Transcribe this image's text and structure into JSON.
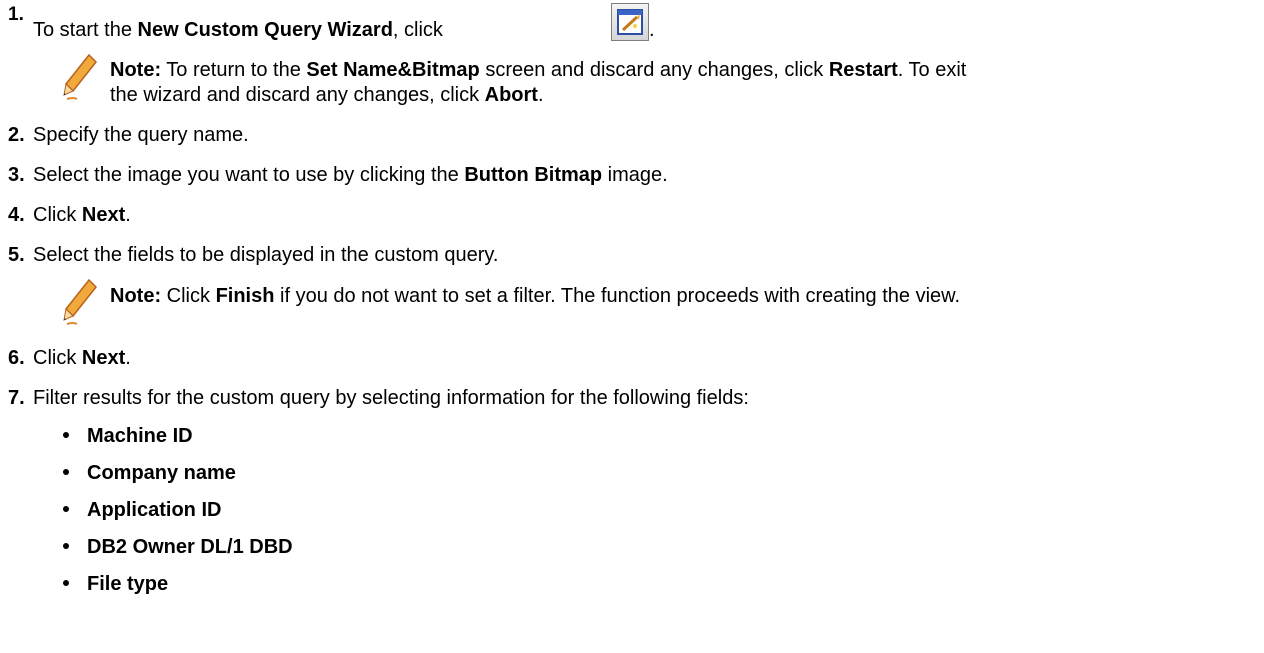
{
  "step1": {
    "number": "1.",
    "text_before": "To start the ",
    "wizard_name": "New Custom Query Wizard",
    "text_after": ", click ",
    "icon": "custom-query-wizard-icon",
    "trailing": "."
  },
  "note1": {
    "icon": "pencil-icon",
    "label": "Note:",
    "line1_a": " To return to the ",
    "line1_b": "Set Name&Bitmap",
    "line1_c": " screen and discard any changes, click ",
    "line1_d": "Restart",
    "line1_e": ". To exit",
    "line2_a": "the wizard and discard any changes, click ",
    "line2_b": "Abort",
    "line2_c": "."
  },
  "step2": {
    "number": "2.",
    "text": "Specify the query name."
  },
  "step3": {
    "number": "3.",
    "text_a": "Select the image you want to use by clicking the ",
    "text_b": "Button Bitmap",
    "text_c": " image."
  },
  "step4": {
    "number": "4.",
    "text_a": "Click ",
    "text_b": "Next",
    "text_c": "."
  },
  "step5": {
    "number": "5.",
    "text": "Select the fields to be displayed in the custom query."
  },
  "note2": {
    "icon": "pencil-icon",
    "label": "Note:",
    "text_a": " Click ",
    "text_b": "Finish",
    "text_c": " if you do not want to set a filter. The function proceeds with creating the view."
  },
  "step6": {
    "number": "6.",
    "text_a": "Click ",
    "text_b": "Next",
    "text_c": "."
  },
  "step7": {
    "number": "7.",
    "text": "Filter results for the custom query by selecting information for the following fields:",
    "fields": [
      "Machine ID",
      "Company name",
      "Application ID",
      "DB2 Owner DL/1 DBD",
      "File type"
    ]
  }
}
